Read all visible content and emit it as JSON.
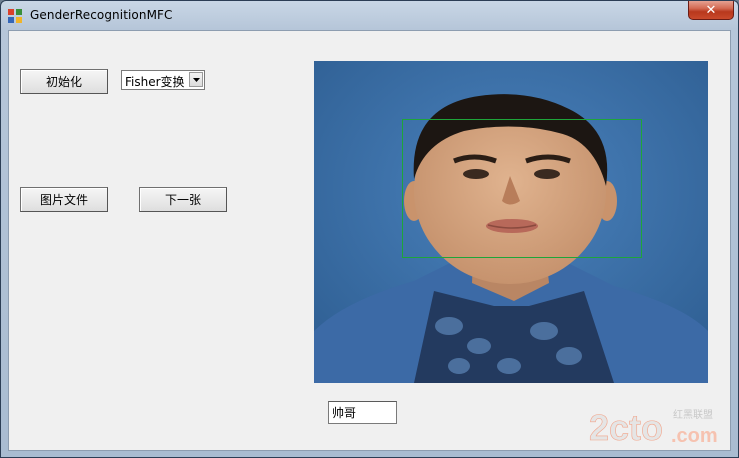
{
  "window": {
    "title": "GenderRecognitionMFC",
    "close_glyph": "✕"
  },
  "controls": {
    "init_button": "初始化",
    "method_select": {
      "selected": "Fisher变换"
    },
    "image_file_button": "图片文件",
    "next_button": "下一张",
    "result_text": "帅哥"
  },
  "image": {
    "description_icon": "portrait-photo",
    "detection_color": "#1ea53a"
  },
  "watermark": {
    "text_main": "2cto",
    "text_domain": ".com",
    "text_cn": "红黑联盟"
  },
  "colors": {
    "close_red": "#c9492b",
    "accent_blue": "#3b6fa7"
  }
}
